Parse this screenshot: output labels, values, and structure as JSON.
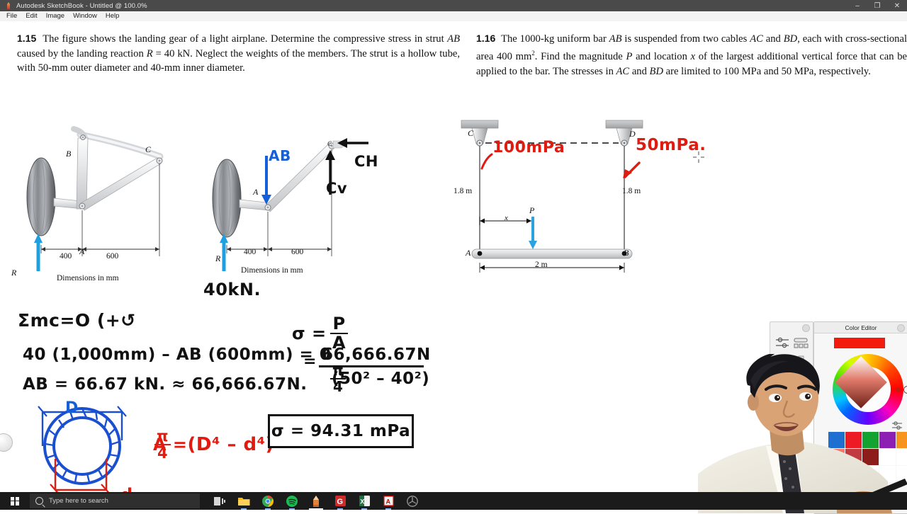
{
  "window": {
    "app_icon": "sketchbook-icon",
    "title": "Autodesk SketchBook - Untitled @ 100.0%",
    "minimize": "–",
    "maximize": "❐",
    "close": "✕"
  },
  "menubar": {
    "items": [
      "File",
      "Edit",
      "Image",
      "Window",
      "Help"
    ]
  },
  "problems": [
    {
      "number": "1.15",
      "text_html": "The figure shows the landing gear of a light airplane. Determine the compressive stress in strut <i>AB</i> caused by the landing reaction <i>R</i> = 40 kN. Neglect the weights of the members. The strut is a hollow tube, with 50-mm outer diameter and 40-mm inner diameter."
    },
    {
      "number": "1.16",
      "text_html": "The 1000-kg uniform bar <i>AB</i> is suspended from two cables <i>AC</i> and <i>BD</i>, each with cross-sectional area 400 mm<sup>2</sup>. Find the magnitude <i>P</i> and location <i>x</i> of the largest additional vertical force that can be applied to the bar. The stresses in <i>AC</i> and <i>BD</i> are limited to 100 MPa and 50 MPa, respectively."
    }
  ],
  "figure1": {
    "labels": {
      "A": "A",
      "B": "B",
      "C": "C",
      "R": "R"
    },
    "dim_400": "400",
    "dim_600": "600",
    "caption": "Dimensions in mm"
  },
  "figure2": {
    "labels": {
      "A": "A",
      "C": "C",
      "R": "R"
    },
    "dim_400": "400",
    "dim_600": "600",
    "caption": "Dimensions in mm",
    "annotation_AB": "AB",
    "annotation_CH": "CH",
    "annotation_CV": "Cv",
    "annotation_40kn": "40kN."
  },
  "figure3": {
    "labels": {
      "A": "A",
      "B": "B",
      "C": "C",
      "D": "D",
      "P": "P",
      "x": "x"
    },
    "left_height": "1.8 m",
    "right_height": "1.8 m",
    "span": "2 m",
    "annotation_left": "100mPa",
    "annotation_right": "50mPa."
  },
  "work": {
    "line1": "Σmc = 0 (+↻",
    "line1_plain": "Σmc=O (+↺",
    "line2": "40 (1,000mm) – AB (600mm) = 0",
    "line3": "AB = 66.67 kN. ≈ 66,666.67N.",
    "sigma_sym": "σ =",
    "frac1_top": "P",
    "frac1_bot": "A",
    "equals": "=",
    "frac2_top": "66,666.67N",
    "frac2_bot_pi": "π",
    "frac2_bot_4": "4",
    "frac2_bot_rest": "(50² – 40²)",
    "area_formula_lead": "A =",
    "area_pi": "π",
    "area_4": "4",
    "area_rest": "(D⁴ – d⁴)",
    "answer": "σ = 94.31 mPa",
    "tube_D": "D",
    "tube_d": "d"
  },
  "color_editor": {
    "title": "Color Editor",
    "current_color": "#f21b0c",
    "swatches": [
      "#1f6fd0",
      "#ed1c24",
      "#14a330",
      "#8d1fb5",
      "#f7941e",
      "#ef7a6e",
      "#c03a3f",
      "#8c1d1b",
      "#ffffff",
      "#ffffff",
      "#2f9c7a",
      "#f6b24a",
      "#ffffff",
      "#ffffff",
      "#ffffff"
    ]
  },
  "taskbar": {
    "start": "start-button",
    "search_placeholder": "Type here to search",
    "apps": [
      {
        "name": "task-view",
        "color": "#d6d6d6"
      },
      {
        "name": "file-explorer",
        "color": "#ffb900"
      },
      {
        "name": "google-chrome",
        "color": "#34a853"
      },
      {
        "name": "spotify",
        "color": "#1db954"
      },
      {
        "name": "autodesk-sketchbook",
        "color": "#e08a3c"
      },
      {
        "name": "grammarly",
        "color": "#cf2b2b"
      },
      {
        "name": "microsoft-excel",
        "color": "#1d6f42"
      },
      {
        "name": "adobe-acrobat",
        "color": "#b30b00"
      },
      {
        "name": "obs-studio",
        "color": "#8f8f8f"
      }
    ]
  }
}
